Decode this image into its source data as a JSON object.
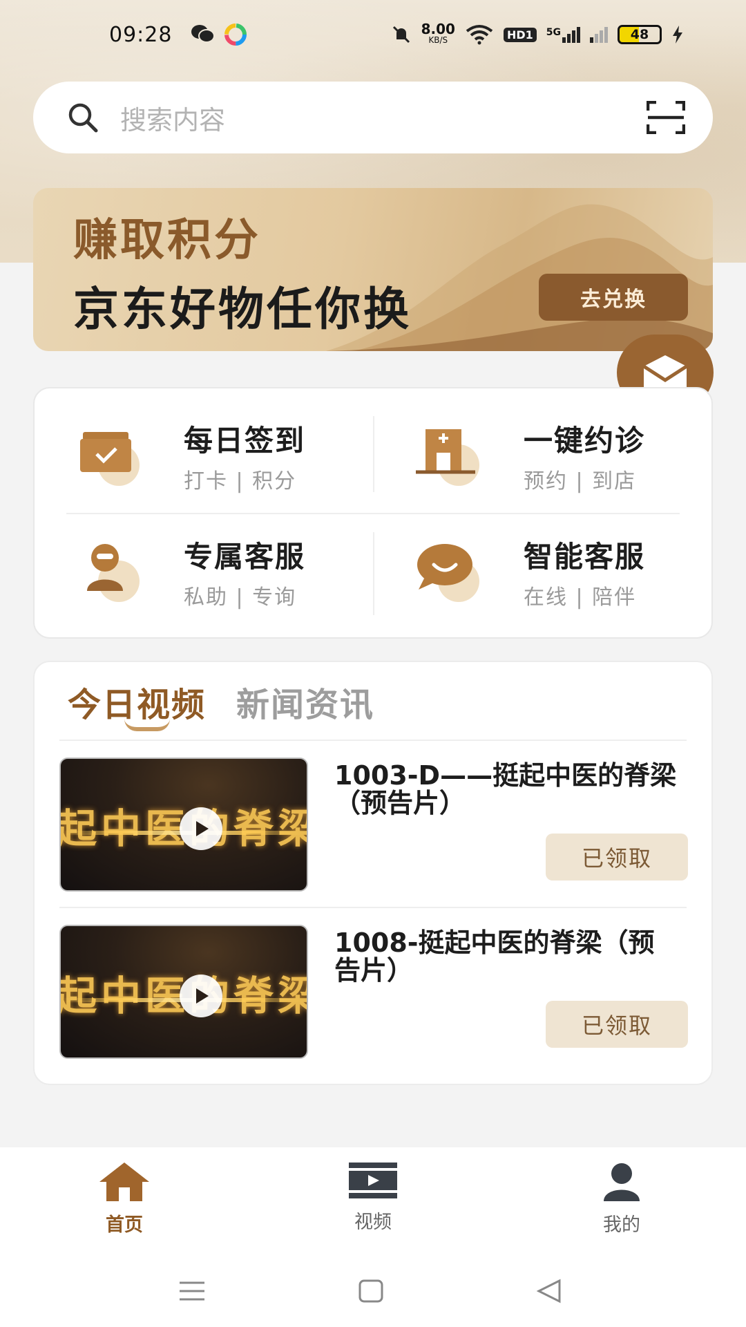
{
  "status_bar": {
    "time": "09:28",
    "net_speed": "8.00",
    "net_unit": "KB/S",
    "hd_badge": "HD1",
    "net_type": "5G",
    "battery": "48"
  },
  "search": {
    "placeholder": "搜索内容",
    "icon": "search-icon",
    "scan_icon": "scan-icon"
  },
  "banner": {
    "line1": "赚取积分",
    "line2": "京东好物任你换",
    "button": "去兑换"
  },
  "quick_actions": [
    {
      "title": "每日签到",
      "sub": "打卡 | 积分",
      "icon": "checkin-icon"
    },
    {
      "title": "一键约诊",
      "sub": "预约 | 到店",
      "icon": "clinic-icon"
    },
    {
      "title": "专属客服",
      "sub": "私助 | 专询",
      "icon": "service-person-icon"
    },
    {
      "title": "智能客服",
      "sub": "在线 | 陪伴",
      "icon": "chat-bubble-icon"
    }
  ],
  "tabs": [
    {
      "label": "今日视频",
      "active": true
    },
    {
      "label": "新闻资讯",
      "active": false
    }
  ],
  "videos": [
    {
      "title": "1003-D——挺起中医的脊梁（预告片）",
      "status": "已领取",
      "thumb_caption": "起中医的脊梁"
    },
    {
      "title": "1008-挺起中医的脊梁（预告片）",
      "status": "已领取",
      "thumb_caption": "起中医的脊梁"
    }
  ],
  "bottom_nav": [
    {
      "label": "首页",
      "icon": "home-icon",
      "active": true
    },
    {
      "label": "视频",
      "icon": "video-icon",
      "active": false
    },
    {
      "label": "我的",
      "icon": "profile-icon",
      "active": false
    }
  ],
  "colors": {
    "accent": "#8f5a25",
    "claimed_bg": "#efe4d2",
    "banner_button": "#8a5a2e"
  }
}
